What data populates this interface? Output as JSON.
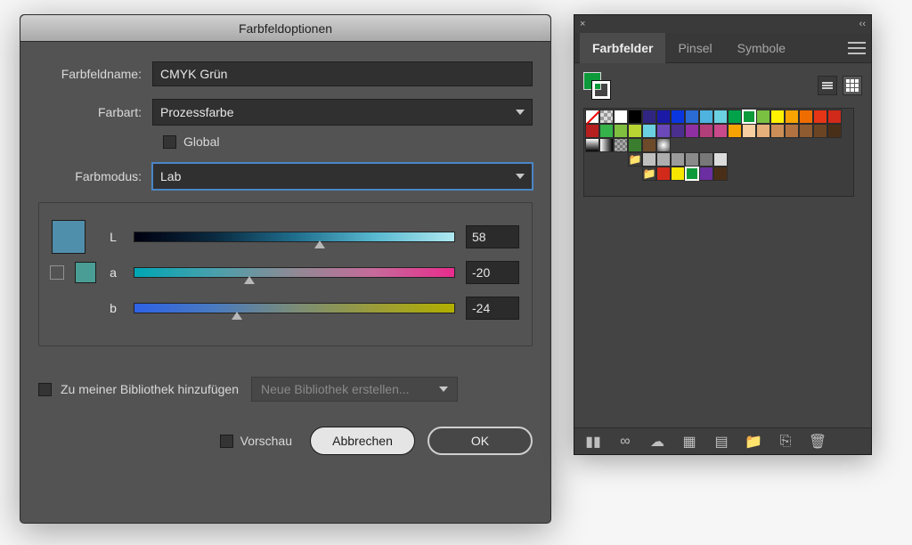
{
  "dialog": {
    "title": "Farbfeldoptionen",
    "name_label": "Farbfeldname:",
    "name_value": "CMYK Grün",
    "colortype_label": "Farbart:",
    "colortype_value": "Prozessfarbe",
    "global_label": "Global",
    "global_checked": false,
    "mode_label": "Farbmodus:",
    "mode_value": "Lab",
    "channels": {
      "L": {
        "label": "L",
        "value": "58",
        "thumb_pct": 58
      },
      "a": {
        "label": "a",
        "value": "-20",
        "thumb_pct": 36
      },
      "b": {
        "label": "b",
        "value": "-24",
        "thumb_pct": 32
      }
    },
    "preview_swatch_color": "#508fab",
    "secondary_swatch_color": "#4a9d95",
    "library_label": "Zu meiner Bibliothek hinzufügen",
    "library_checked": false,
    "library_select": "Neue Bibliothek erstellen...",
    "preview_checkbox_label": "Vorschau",
    "preview_checked": false,
    "cancel": "Abbrechen",
    "ok": "OK"
  },
  "panel": {
    "close_glyph": "×",
    "collapse_glyph": "‹‹",
    "tabs": [
      "Farbfelder",
      "Pinsel",
      "Symbole"
    ],
    "active_tab": 0,
    "fill_color": "#0c9a3a",
    "swatch_rows": [
      [
        "none",
        "reg",
        "#ffffff",
        "#000000",
        "#302681",
        "#1b1aa6",
        "#0a36e0",
        "#2a6bd4",
        "#4fb3df",
        "#6bd0e0",
        "#00a34a",
        "#0c9a3a",
        "#7ac142",
        "#fff200",
        "#f7a400",
        "#ef6c00",
        "#e53516",
        "#d12a1a",
        "#b61f1f"
      ],
      [
        "#36b24a",
        "#7fbe3f",
        "#b7d433",
        "#6bd0e0",
        "#6b49b8",
        "#4b2f8e",
        "#8f2fa1",
        "#b23e7a",
        "#c84a8a",
        "#f7a400",
        "#f7cfa0",
        "#e5b07a",
        "#cc8e56",
        "#b37341",
        "#8e5a30",
        "#6b4423",
        "#4a2f18",
        "grad1",
        "grad2"
      ],
      [
        "trn",
        "#3a7d2e",
        "#6d4b2a",
        "radg",
        "",
        "",
        "",
        "",
        "",
        "",
        "",
        "",
        "",
        "",
        "",
        "",
        "",
        "",
        ""
      ],
      [
        "folder",
        "#bfbfbf",
        "#adadad",
        "#9b9b9b",
        "#8a8a8a",
        "#787878",
        "#dcdcdc",
        "",
        "",
        "",
        "",
        "",
        "",
        "",
        "",
        "",
        "",
        "",
        ""
      ],
      [
        "folder",
        "#d12a1a",
        "#f7e600",
        "#0c9a3a",
        "#6b2fa1",
        "#4a2f18",
        "",
        "",
        "",
        "",
        "",
        "",
        "",
        "",
        "",
        "",
        "",
        "",
        ""
      ]
    ],
    "footer_icons": [
      "library-icon",
      "link-icon",
      "cloud-icon",
      "swatch-options-icon",
      "new-color-group-icon",
      "folder-icon",
      "new-swatch-icon",
      "trash-icon"
    ]
  }
}
